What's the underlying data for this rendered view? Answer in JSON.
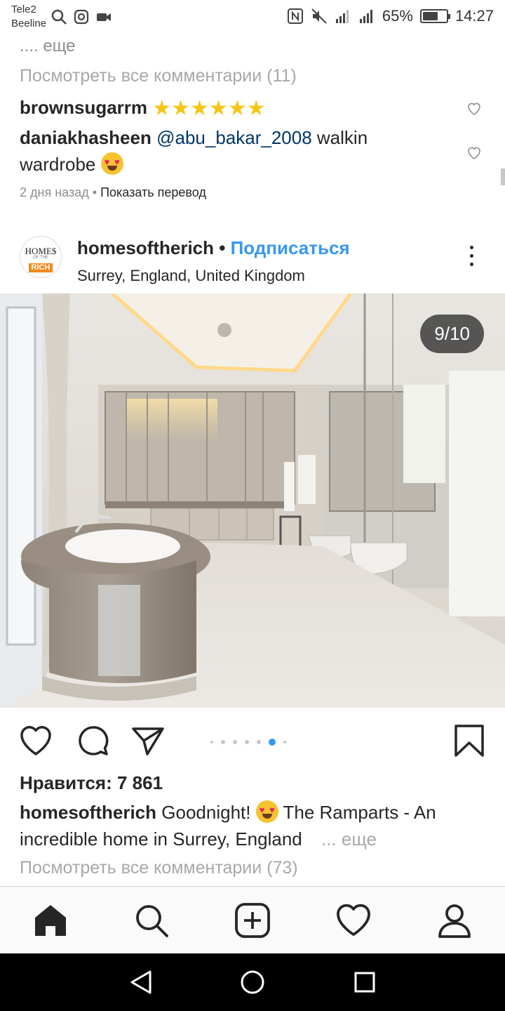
{
  "status_bar": {
    "carrier_1": "Tele2",
    "carrier_2": "Beeline",
    "battery": "65%",
    "battery_level": 0.65,
    "time": "14:27",
    "icons": [
      "search-icon",
      "instagram-icon",
      "video-icon",
      "nfc-icon",
      "mute-icon",
      "signal-icon",
      "signal-icon"
    ]
  },
  "prev_post": {
    "more_link": ".... еще",
    "view_all_comments": "Посмотреть все комментарии (11)",
    "comments": [
      {
        "user": "brownsugarrm",
        "text": "⭐⭐⭐⭐⭐⭐",
        "emoji_count": 6
      },
      {
        "user": "daniakhasheen",
        "mention": "@abu_bakar_2008",
        "text_1": "walkin",
        "text_2": "wardrobe"
      }
    ],
    "time_ago": "2 дня назад",
    "separator": "•",
    "translate": "Показать перевод"
  },
  "post": {
    "avatar_text": {
      "line1": "HOME$",
      "line2": "OF THE",
      "line3": "RICH"
    },
    "username": "homesoftherich",
    "separator": "•",
    "follow": "Подписаться",
    "location": "Surrey, England, United Kingdom",
    "image_counter": "9/10",
    "carousel": {
      "total_dots": 7,
      "active_index": 5
    },
    "likes": "Нравится: 7 861",
    "caption_user": "homesoftherich",
    "caption_text_1": "Goodnight!",
    "caption_text_2": "The Ramparts - An",
    "caption_text_3": "incredible home in Surrey, England",
    "caption_more": "... еще",
    "view_all_comments": "Посмотреть все комментарии (73)"
  },
  "bottom_nav": [
    "home-icon",
    "search-icon",
    "add-post-icon",
    "activity-heart-icon",
    "profile-icon"
  ],
  "android_nav": [
    "back-icon",
    "home-circle-icon",
    "recents-icon"
  ],
  "colors": {
    "link_blue": "#3897f0",
    "mention_blue": "#003569",
    "text": "#262626",
    "muted": "#8e8e8e"
  }
}
